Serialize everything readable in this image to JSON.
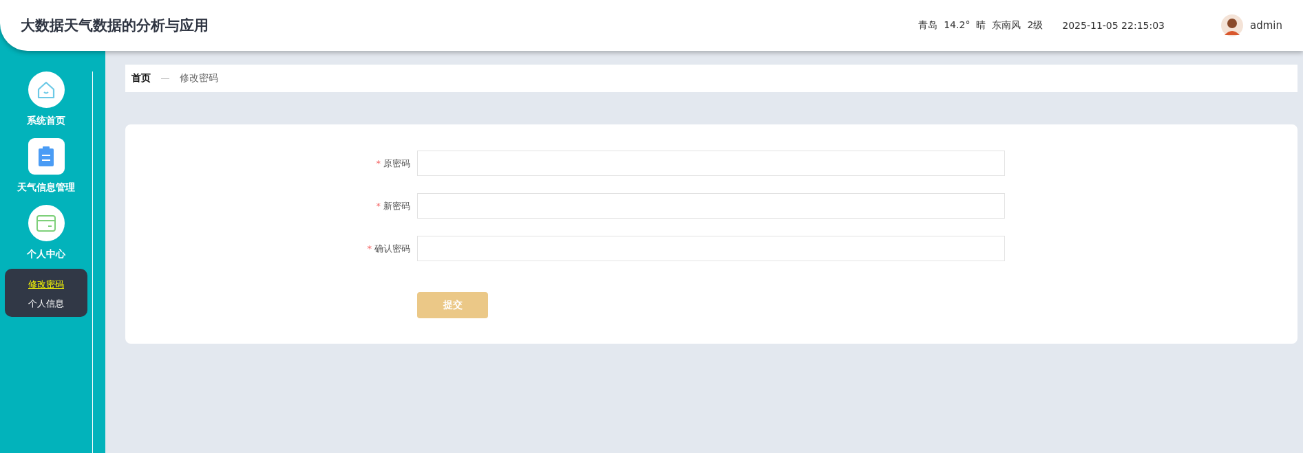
{
  "header": {
    "title": "大数据天气数据的分析与应用",
    "weather": [
      "青岛",
      "14.2°",
      "晴",
      "东南风",
      "2级"
    ],
    "datetime": "2025-11-05 22:15:03",
    "user": "admin"
  },
  "sidebar": {
    "items": [
      {
        "label": "系统首页",
        "kind": "home"
      },
      {
        "label": "天气信息管理",
        "kind": "clipboard"
      },
      {
        "label": "个人中心",
        "kind": "card",
        "expanded": true,
        "children": [
          {
            "label": "修改密码",
            "selected": true
          },
          {
            "label": "个人信息",
            "selected": false
          }
        ]
      }
    ]
  },
  "breadcrumb": [
    "首页",
    "修改密码"
  ],
  "form": {
    "fields": [
      {
        "label": "原密码",
        "required": true,
        "marker": "*"
      },
      {
        "label": "新密码",
        "required": true,
        "marker": "*"
      },
      {
        "label": "确认密码",
        "required": true,
        "marker": "*"
      }
    ],
    "submit": "提交"
  }
}
